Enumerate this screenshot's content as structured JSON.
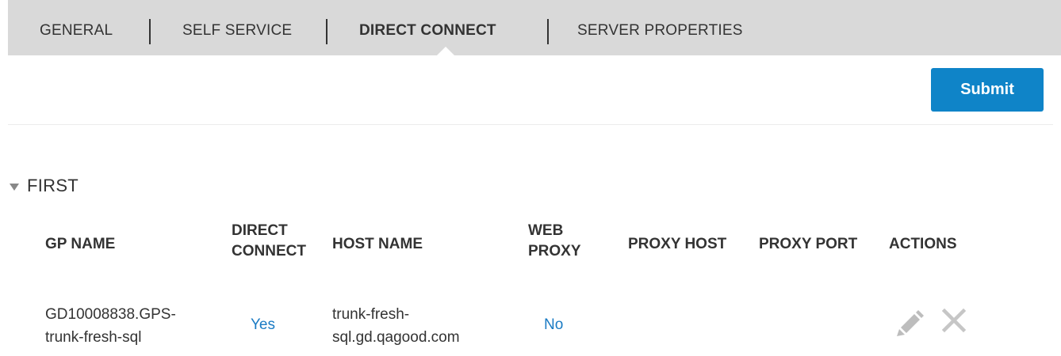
{
  "tabs": [
    {
      "label": "GENERAL",
      "active": false
    },
    {
      "label": "SELF SERVICE",
      "active": false
    },
    {
      "label": "DIRECT CONNECT",
      "active": true
    },
    {
      "label": "SERVER PROPERTIES",
      "active": false
    }
  ],
  "toolbar": {
    "submit_label": "Submit"
  },
  "section": {
    "title": "FIRST",
    "columns": {
      "gp_name": "GP NAME",
      "direct_connect_l1": "DIRECT",
      "direct_connect_l2": "CONNECT",
      "host_name": "HOST NAME",
      "web_proxy_l1": "WEB",
      "web_proxy_l2": "PROXY",
      "proxy_host": "PROXY HOST",
      "proxy_port": "PROXY PORT",
      "actions": "ACTIONS"
    },
    "rows": [
      {
        "gp_name_l1": "GD10008838.GPS-",
        "gp_name_l2": "trunk-fresh-sql",
        "direct_connect": "Yes",
        "host_name_l1": "trunk-fresh-",
        "host_name_l2": "sql.gd.qagood.com",
        "web_proxy": "No",
        "proxy_host": "",
        "proxy_port": ""
      }
    ]
  },
  "icons": {
    "edit": "pencil-icon",
    "delete": "close-icon"
  },
  "colors": {
    "accent": "#0f84c8",
    "link": "#1a7bc4",
    "tabbar": "#d9d9d9",
    "icon": "#bdbdbd"
  }
}
